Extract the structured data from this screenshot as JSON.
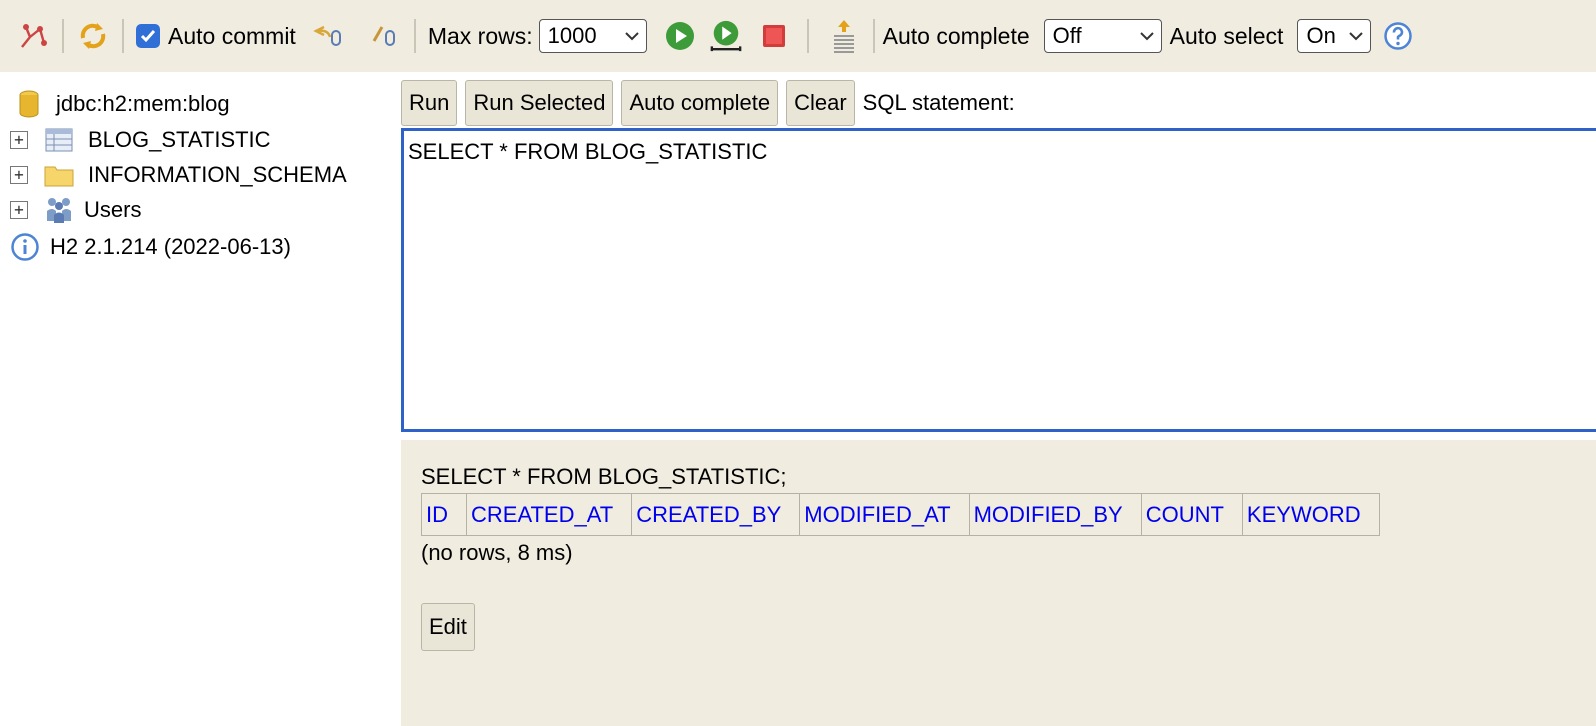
{
  "toolbar": {
    "auto_commit_label": "Auto commit",
    "max_rows_label": "Max rows:",
    "max_rows_value": "1000",
    "auto_complete_label": "Auto complete",
    "auto_complete_value": "Off",
    "auto_select_label": "Auto select",
    "auto_select_value": "On"
  },
  "tree": {
    "connection": "jdbc:h2:mem:blog",
    "items": [
      {
        "label": "BLOG_STATISTIC",
        "icon": "table-icon"
      },
      {
        "label": "INFORMATION_SCHEMA",
        "icon": "folder-icon"
      },
      {
        "label": "Users",
        "icon": "users-icon"
      }
    ],
    "version": "H2 2.1.214 (2022-06-13)"
  },
  "query": {
    "run_label": "Run",
    "run_selected_label": "Run Selected",
    "auto_complete_label": "Auto complete",
    "clear_label": "Clear",
    "sql_statement_label": "SQL statement:",
    "sql_text": "SELECT * FROM BLOG_STATISTIC"
  },
  "result": {
    "sql": "SELECT * FROM BLOG_STATISTIC;",
    "columns": [
      "ID",
      "CREATED_AT",
      "CREATED_BY",
      "MODIFIED_AT",
      "MODIFIED_BY",
      "COUNT",
      "KEYWORD"
    ],
    "info": "(no rows, 8 ms)",
    "edit_label": "Edit"
  },
  "colors": {
    "toolbar_bg": "#f0ede0",
    "editor_border": "#2d62c9",
    "link": "#0000ee",
    "checkbox": "#2f6fd6"
  }
}
